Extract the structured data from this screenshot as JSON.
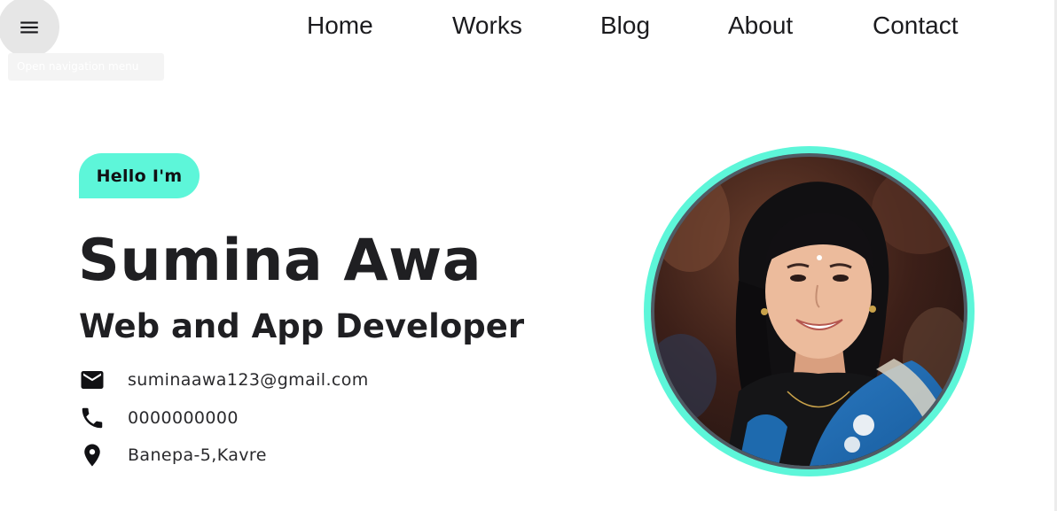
{
  "menu": {
    "icon": "menu-icon",
    "tooltip": "Open navigation menu"
  },
  "nav": {
    "home": "Home",
    "works": "Works",
    "blog": "Blog",
    "about": "About",
    "contact": "Contact"
  },
  "hero": {
    "greeting": "Hello I'm",
    "name": "Sumina Awa",
    "role": "Web and App Developer"
  },
  "contacts": [
    {
      "icon": "email-icon",
      "text": "suminaawa123@gmail.com"
    },
    {
      "icon": "phone-icon",
      "text": "0000000000"
    },
    {
      "icon": "location-pin-icon",
      "text": "Banepa-5,Kavre"
    }
  ],
  "colors": {
    "accent": "#5df6d9",
    "text": "#1f1f22",
    "menu_button": "#e6e6e6"
  }
}
